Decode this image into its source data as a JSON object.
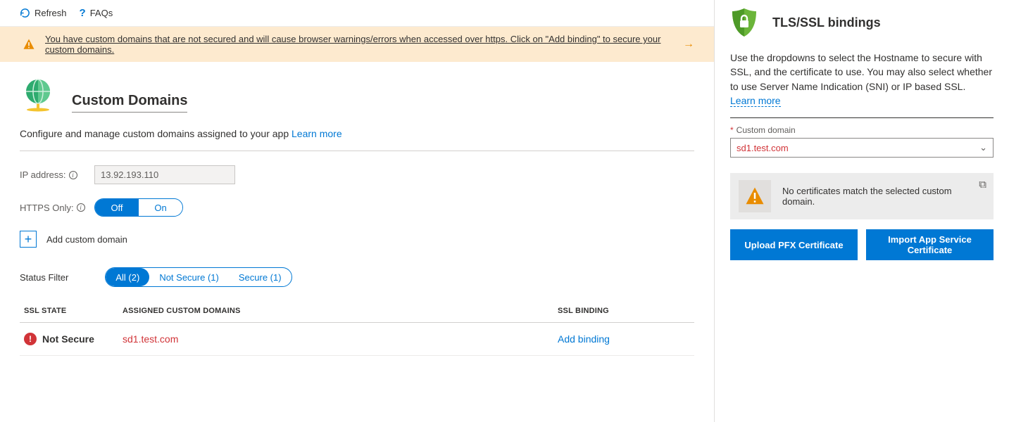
{
  "toolbar": {
    "refresh": "Refresh",
    "faqs": "FAQs"
  },
  "warning": "You have custom domains that are not secured and will cause browser warnings/errors when accessed over https. Click on \"Add binding\" to secure your custom domains.",
  "page": {
    "title": "Custom Domains",
    "desc": "Configure and manage custom domains assigned to your app ",
    "learn_more": "Learn more"
  },
  "ip": {
    "label": "IP address:",
    "value": "13.92.193.110"
  },
  "https": {
    "label": "HTTPS Only:",
    "off": "Off",
    "on": "On"
  },
  "add_domain": "Add custom domain",
  "filter": {
    "label": "Status Filter",
    "all": "All (2)",
    "not_secure": "Not Secure (1)",
    "secure": "Secure (1)"
  },
  "table": {
    "col_ssl": "SSL STATE",
    "col_dom": "ASSIGNED CUSTOM DOMAINS",
    "col_bind": "SSL BINDING",
    "row": {
      "state": "Not Secure",
      "domain": "sd1.test.com",
      "binding": "Add binding"
    }
  },
  "panel": {
    "title": "TLS/SSL bindings",
    "desc": "Use the dropdowns to select the Hostname to secure with SSL, and the certificate to use. You may also select whether to use Server Name Indication (SNI) or IP based SSL. ",
    "learn_more": "Learn more",
    "field_label": "Custom domain",
    "selected": "sd1.test.com",
    "alert": "No certificates match the selected custom domain.",
    "btn_upload": "Upload PFX Certificate",
    "btn_import": "Import App Service Certificate"
  }
}
